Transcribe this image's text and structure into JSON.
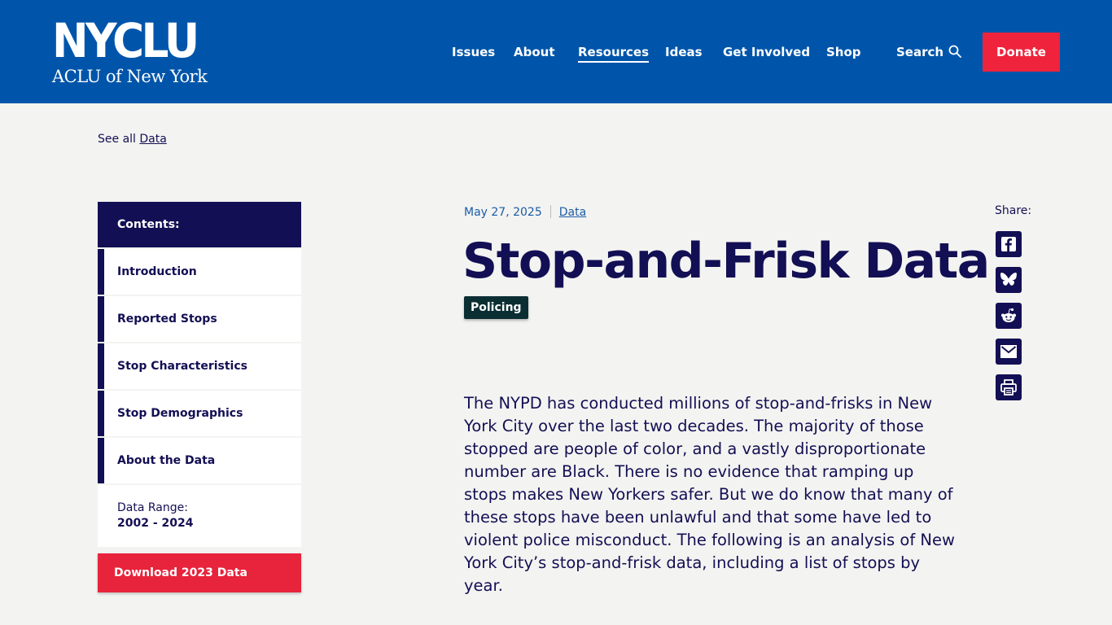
{
  "header": {
    "logo_main": "NYCLU",
    "logo_sub": "ACLU of New York",
    "nav": [
      "Issues",
      "About",
      "Resources",
      "Ideas",
      "Get Involved",
      "Shop"
    ],
    "active_nav": "Resources",
    "search_label": "Search",
    "donate_label": "Donate"
  },
  "breadcrumb": {
    "prefix": "See all",
    "link": "Data"
  },
  "toc": {
    "heading": "Contents:",
    "items": [
      "Introduction",
      "Reported Stops",
      "Stop Characteristics",
      "Stop Demographics",
      "About the Data"
    ],
    "range_label": "Data Range:",
    "range_value": "2002 - 2024",
    "download_label": "Download 2023 Data"
  },
  "article": {
    "date": "May 27, 2025",
    "category": "Data",
    "title": "Stop-and-Frisk Data",
    "tag": "Policing",
    "lede": "The NYPD has conducted millions of stop-and-frisks in New York City over the last two decades. The majority of those stopped are people of color, and a vastly disproportionate number are Black. There is no evidence that ramping up stops makes New Yorkers safer. But we do know that many of these stops have been unlawful and that some have led to violent police misconduct. The following is an analysis of New York City’s stop-and-frisk data, including a list of stops by year."
  },
  "share": {
    "label": "Share:",
    "buttons": [
      "facebook-icon",
      "bluesky-icon",
      "reddit-icon",
      "email-icon",
      "print-icon"
    ]
  },
  "colors": {
    "header_bg": "#0055aa",
    "donate": "#ef233c",
    "navy": "#130f54",
    "tag_bg": "#0b2e33",
    "page_bg": "#f3f3f1"
  }
}
